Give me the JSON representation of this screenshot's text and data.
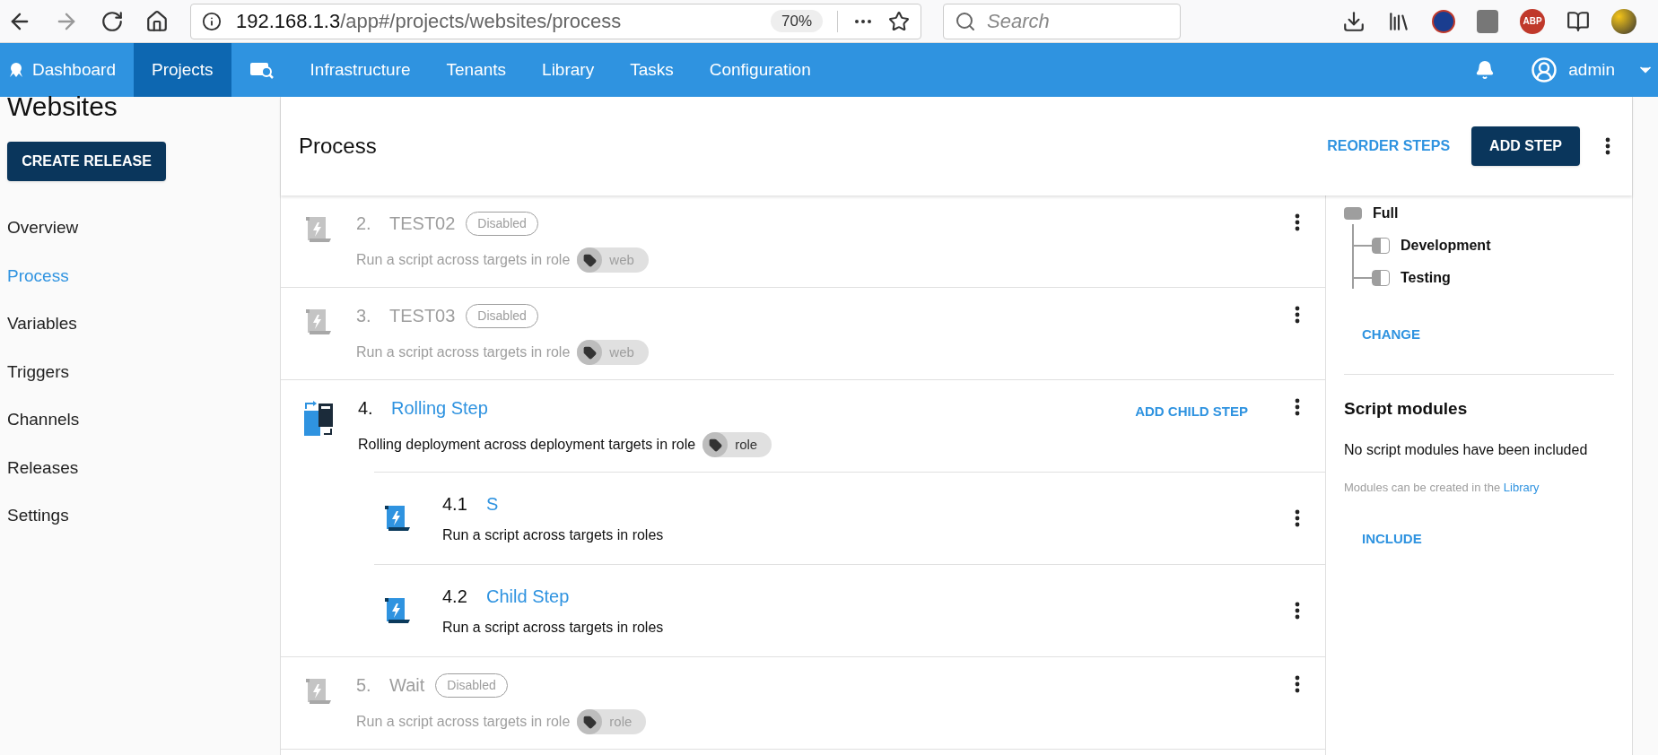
{
  "browser": {
    "url_host": "192.168.1.3",
    "url_path": "/app#/projects/websites/process",
    "zoom": "70%",
    "search_placeholder": "Search",
    "abp_badge": "ABP"
  },
  "nav": {
    "items": [
      {
        "kind": "logo",
        "label": "Dashboard",
        "selected": false
      },
      {
        "kind": "text",
        "label": "Projects",
        "selected": true
      },
      {
        "kind": "icon",
        "selected": false
      },
      {
        "kind": "text",
        "label": "Infrastructure",
        "selected": false
      },
      {
        "kind": "text",
        "label": "Tenants",
        "selected": false
      },
      {
        "kind": "text",
        "label": "Library",
        "selected": false
      },
      {
        "kind": "text",
        "label": "Tasks",
        "selected": false
      },
      {
        "kind": "text",
        "label": "Configuration",
        "selected": false
      }
    ],
    "user": "admin"
  },
  "sidebar": {
    "title": "Websites",
    "button": "CREATE RELEASE",
    "items": [
      {
        "label": "Overview",
        "selected": false
      },
      {
        "label": "Process",
        "selected": true
      },
      {
        "label": "Variables",
        "selected": false
      },
      {
        "label": "Triggers",
        "selected": false
      },
      {
        "label": "Channels",
        "selected": false
      },
      {
        "label": "Releases",
        "selected": false
      },
      {
        "label": "Settings",
        "selected": false
      }
    ]
  },
  "process": {
    "title": "Process",
    "reorder": "REORDER STEPS",
    "add_step": "ADD STEP"
  },
  "steps": [
    {
      "kind": "script",
      "number": "2.",
      "name": "TEST02",
      "disabled": true,
      "badge": "Disabled",
      "description": "Run a script across targets in role",
      "role": "web"
    },
    {
      "kind": "script",
      "number": "3.",
      "name": "TEST03",
      "disabled": true,
      "badge": "Disabled",
      "description": "Run a script across targets in role",
      "role": "web"
    },
    {
      "kind": "rolling",
      "number": "4.",
      "name": "Rolling Step",
      "disabled": false,
      "description": "Rolling deployment across deployment targets in role",
      "role": "role",
      "add_child": "ADD CHILD STEP",
      "children": [
        {
          "number": "4.1",
          "name": "S",
          "description": "Run a script across targets in roles"
        },
        {
          "number": "4.2",
          "name": "Child Step",
          "description": "Run a script across targets in roles"
        }
      ]
    },
    {
      "kind": "script",
      "number": "5.",
      "name": "Wait",
      "disabled": true,
      "badge": "Disabled",
      "description": "Run a script across targets in role",
      "role": "role"
    }
  ],
  "side_panel": {
    "lifecycle": {
      "name": "Full",
      "children": [
        "Development",
        "Testing"
      ]
    },
    "change": "CHANGE",
    "modules_title": "Script modules",
    "modules_empty": "No script modules have been included",
    "modules_hint": "Modules can be created in the",
    "modules_link": "Library",
    "include": "INCLUDE"
  }
}
